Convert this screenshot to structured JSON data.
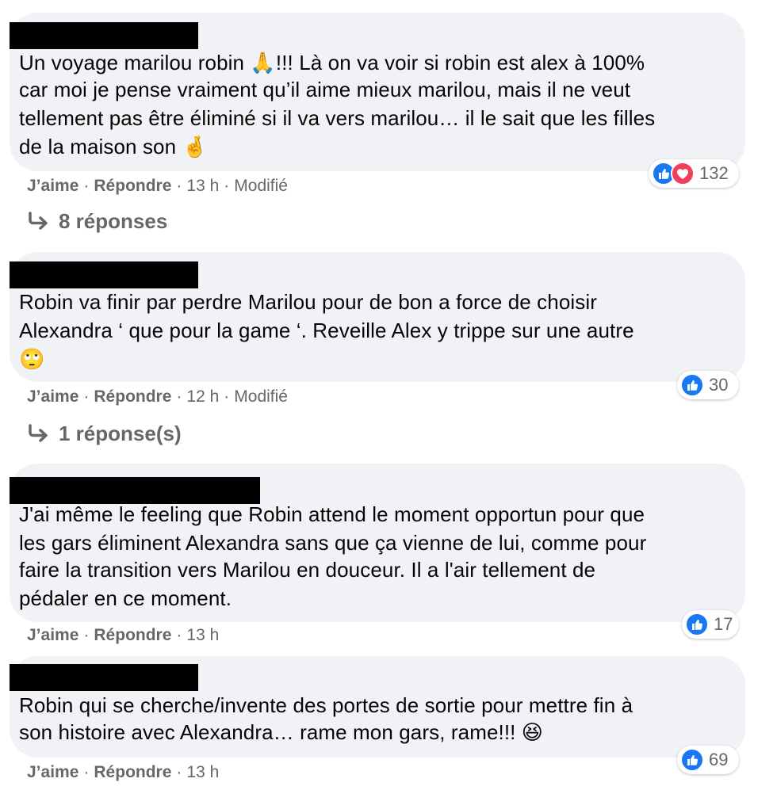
{
  "comments": [
    {
      "lines": [
        "Un voyage marilou robin 🙏!!! Là on va voir si robin est alex à 100%",
        "car moi je pense vraiment qu’il aime mieux marilou, mais il ne veut",
        "tellement pas être éliminé si il va vers marilou… il le sait que les filles",
        "de la maison son 🤞"
      ],
      "like_label": "J’aime",
      "reply_label": "Répondre",
      "time": "13 h",
      "edited": "Modifié",
      "reaction_count": "132",
      "reactions": [
        "like-icon",
        "love-icon"
      ],
      "replies_label": "8 réponses"
    },
    {
      "lines": [
        "Robin va finir par perdre Marilou pour de bon a force de choisir",
        "Alexandra ‘ que pour la game ‘. Reveille Alex y trippe sur une autre",
        "🙄"
      ],
      "like_label": "J’aime",
      "reply_label": "Répondre",
      "time": "12 h",
      "edited": "Modifié",
      "reaction_count": "30",
      "reactions": [
        "like-icon"
      ],
      "replies_label": "1 réponse(s)"
    },
    {
      "lines": [
        "J'ai même le feeling que Robin attend le moment opportun pour que",
        "les gars éliminent Alexandra sans que ça vienne de lui, comme pour",
        "faire la transition vers Marilou en douceur. Il a l'air tellement de",
        "pédaler en ce moment."
      ],
      "like_label": "J’aime",
      "reply_label": "Répondre",
      "time": "13 h",
      "reaction_count": "17",
      "reactions": [
        "like-icon"
      ]
    },
    {
      "lines": [
        "Robin qui se cherche/invente des portes de sortie pour mettre fin à",
        "son histoire avec Alexandra… rame mon gars, rame!!! 😆"
      ],
      "like_label": "J’aime",
      "reply_label": "Répondre",
      "time": "13 h",
      "reaction_count": "69",
      "reactions": [
        "like-icon"
      ]
    }
  ],
  "colors": {
    "bubble": "#f0f2f5",
    "meta_text": "#65676b",
    "like_blue": "#1877f2",
    "love_red": "#f33e58",
    "redaction": "#000000"
  }
}
